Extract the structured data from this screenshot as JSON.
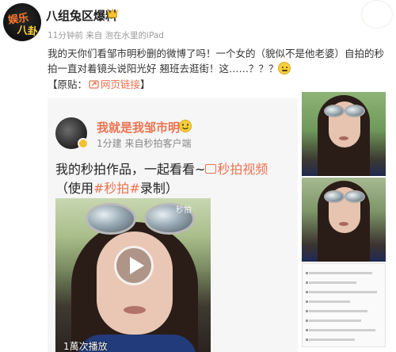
{
  "post": {
    "author": "八组兔区爆料",
    "avatar_text_1": "娱乐",
    "avatar_text_2": "八卦",
    "meta": "11分钟前 来自 泡在水里的iPad",
    "text": "我的天你们看邹市明秒删的微博了吗！一个女的（貌似不是他老婆）自拍的秒拍一直对着镜头说阳光好 翘班去逛街！这……？？？",
    "source_prefix": "【原贴：",
    "source_link": "网页链接",
    "source_suffix": "】"
  },
  "repost": {
    "author": "我就是我邹市明",
    "meta": "1分建 来自秒拍客户端",
    "text_line1_prefix": "我的秒拍作品，一起看看~",
    "text_line1_link": "秒拍视频",
    "text_line2_open": "（使用",
    "text_line2_tag1": "#秒拍#",
    "text_line2_tag2": "录制",
    "text_line2_close": "）",
    "video_watermark": "秒拍",
    "play_count": "1萬次播放"
  },
  "colors": {
    "link": "#eb7350",
    "text": "#333333",
    "meta": "#9a9a9a"
  },
  "icons": {
    "vip": "gold-vip-badge-icon",
    "link": "link-icon",
    "emoji": "smiley-emoji-icon",
    "video": "video-icon",
    "play": "play-icon",
    "chevron": "chevron-down-icon"
  }
}
